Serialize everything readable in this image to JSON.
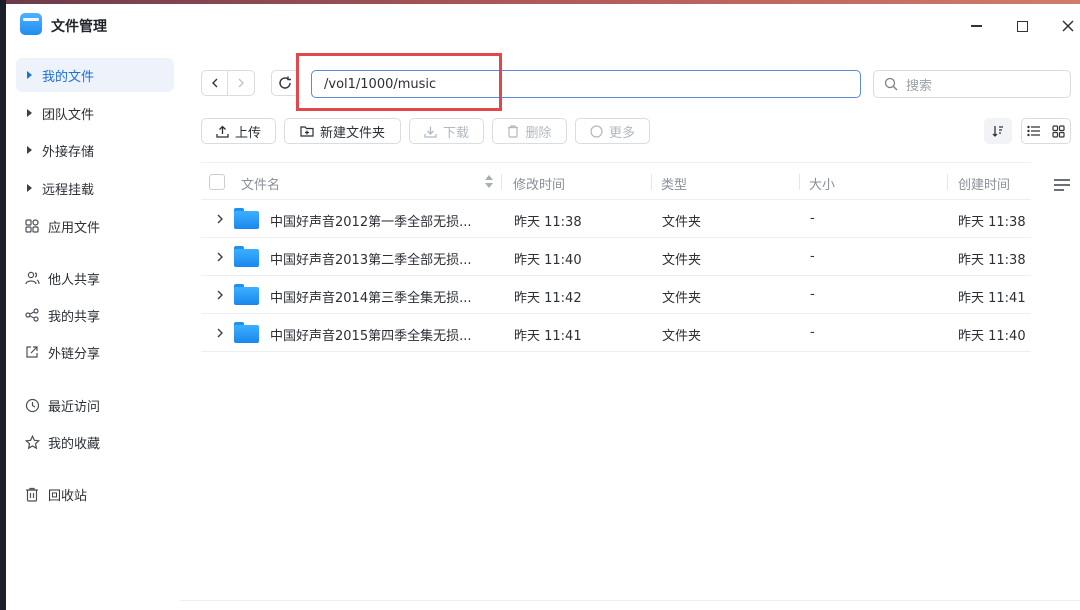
{
  "window": {
    "title": "文件管理"
  },
  "sidebar": {
    "items": [
      {
        "label": "我的文件",
        "icon": "triangle-right-icon",
        "active": true
      },
      {
        "label": "团队文件",
        "icon": "triangle-right-icon"
      },
      {
        "label": "外接存储",
        "icon": "triangle-right-icon"
      },
      {
        "label": "远程挂载",
        "icon": "triangle-right-icon"
      },
      {
        "label": "应用文件",
        "icon": "apps-grid-icon"
      },
      {
        "label": "他人共享",
        "icon": "people-icon"
      },
      {
        "label": "我的共享",
        "icon": "share-icon"
      },
      {
        "label": "外链分享",
        "icon": "external-link-icon"
      },
      {
        "label": "最近访问",
        "icon": "clock-icon"
      },
      {
        "label": "我的收藏",
        "icon": "star-icon"
      },
      {
        "label": "回收站",
        "icon": "trash-icon"
      }
    ]
  },
  "toolbar": {
    "path": "/vol1/1000/music",
    "search_placeholder": "搜索",
    "upload": "上传",
    "new_folder": "新建文件夹",
    "download": "下载",
    "delete": "删除",
    "more": "更多"
  },
  "table": {
    "headers": {
      "name": "文件名",
      "modified": "修改时间",
      "type": "类型",
      "size": "大小",
      "created": "创建时间"
    },
    "rows": [
      {
        "name": "中国好声音2012第一季全部无损...",
        "modified": "昨天 11:38",
        "type": "文件夹",
        "size": "-",
        "created": "昨天 11:38"
      },
      {
        "name": "中国好声音2013第二季全部无损...",
        "modified": "昨天 11:40",
        "type": "文件夹",
        "size": "-",
        "created": "昨天 11:38"
      },
      {
        "name": "中国好声音2014第三季全集无损...",
        "modified": "昨天 11:42",
        "type": "文件夹",
        "size": "-",
        "created": "昨天 11:41"
      },
      {
        "name": "中国好声音2015第四季全集无损...",
        "modified": "昨天 11:41",
        "type": "文件夹",
        "size": "-",
        "created": "昨天 11:40"
      }
    ]
  },
  "colors": {
    "accent": "#1f6fe0",
    "highlight_box": "#e2474a",
    "folder": "#1e90f0"
  }
}
